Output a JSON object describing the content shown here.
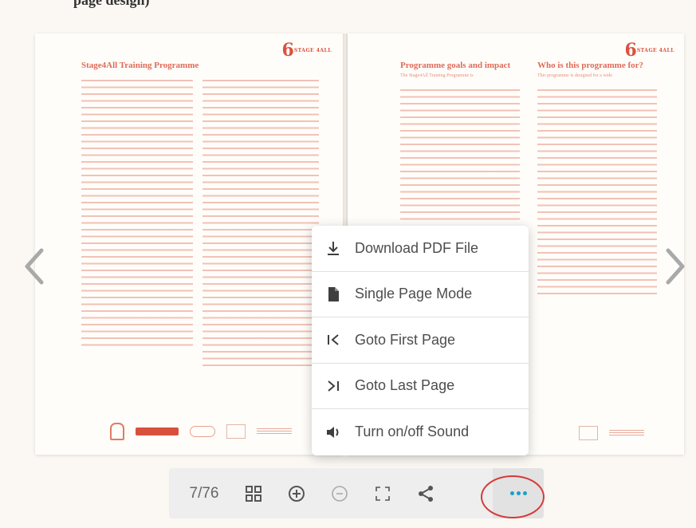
{
  "top_title": "page design)",
  "left_page": {
    "heading": "Stage4All Training Programme",
    "brand_mark": "6",
    "brand_small": "STAGE 4ALL"
  },
  "right_page": {
    "heading_1": "Programme goals and impact",
    "subtext_1": "The Stage4All Training Programme is",
    "heading_2": "Who is this programme for?",
    "subtext_2": "This programme is designed for a wide",
    "brand_mark": "6",
    "brand_small": "STAGE 4ALL"
  },
  "menu": {
    "items": [
      {
        "label": "Download PDF File",
        "icon": "download-icon"
      },
      {
        "label": "Single Page Mode",
        "icon": "document-icon"
      },
      {
        "label": "Goto First Page",
        "icon": "first-page-icon"
      },
      {
        "label": "Goto Last Page",
        "icon": "last-page-icon"
      },
      {
        "label": "Turn on/off Sound",
        "icon": "sound-icon"
      }
    ]
  },
  "toolbar": {
    "page_indicator": "7/76",
    "buttons": [
      "thumbnails-icon",
      "zoom-in-icon",
      "zoom-out-icon",
      "fullscreen-icon",
      "share-icon",
      "more-icon"
    ]
  },
  "colors": {
    "accent_red": "#d9533e",
    "more_dots": "#1aa0c8",
    "highlight_ring": "#d63a3a"
  }
}
